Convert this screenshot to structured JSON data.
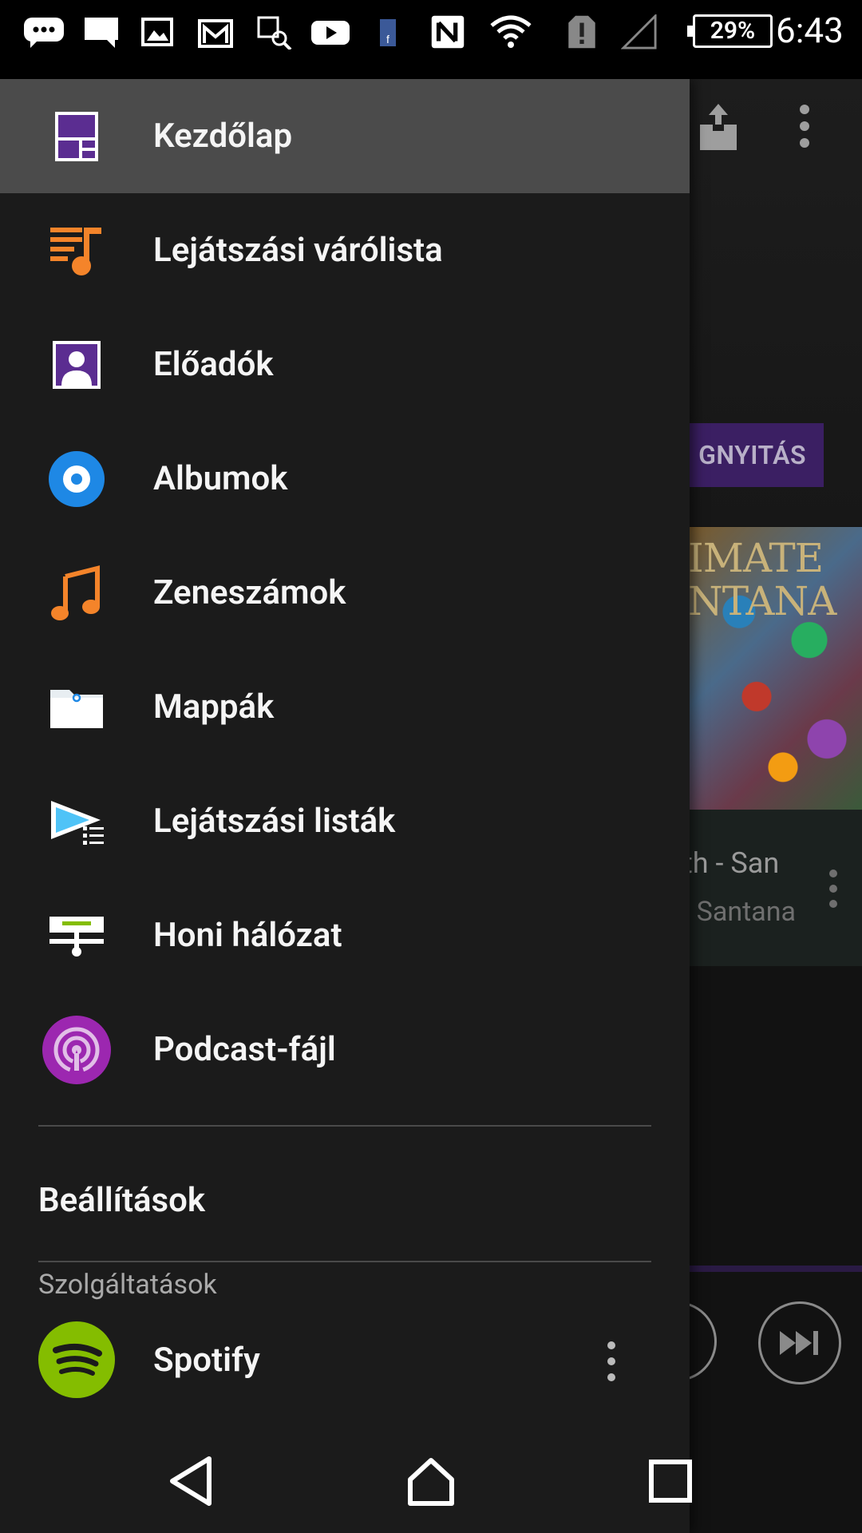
{
  "status_bar": {
    "battery": "29%",
    "time": "6:43"
  },
  "background_app": {
    "open_button_partial": "GNYITÁS",
    "album_title_partial": "IMATE\nNTANA",
    "track_title_partial": "th - San",
    "track_artist_partial": ": Santana"
  },
  "drawer": {
    "items": [
      {
        "label": "Kezdőlap",
        "icon": "home-grid-icon",
        "active": true
      },
      {
        "label": "Lejátszási várólista",
        "icon": "play-queue-icon",
        "active": false
      },
      {
        "label": "Előadók",
        "icon": "artists-icon",
        "active": false
      },
      {
        "label": "Albumok",
        "icon": "album-disc-icon",
        "active": false
      },
      {
        "label": "Zeneszámok",
        "icon": "music-note-icon",
        "active": false
      },
      {
        "label": "Mappák",
        "icon": "folder-icon",
        "active": false
      },
      {
        "label": "Lejátszási listák",
        "icon": "playlist-icon",
        "active": false
      },
      {
        "label": "Honi hálózat",
        "icon": "home-network-icon",
        "active": false
      },
      {
        "label": "Podcast-fájl",
        "icon": "podcast-icon",
        "active": false
      }
    ],
    "settings_label": "Beállítások",
    "services_header": "Szolgáltatások",
    "services": [
      {
        "label": "Spotify",
        "icon": "spotify-icon"
      }
    ]
  },
  "colors": {
    "drawer_bg": "#1b1b1b",
    "active_item_bg": "#4b4b4b",
    "accent_purple": "#5b2d91",
    "accent_orange": "#f4842a",
    "accent_blue": "#1e88e5",
    "spotify_green": "#84bd00"
  }
}
